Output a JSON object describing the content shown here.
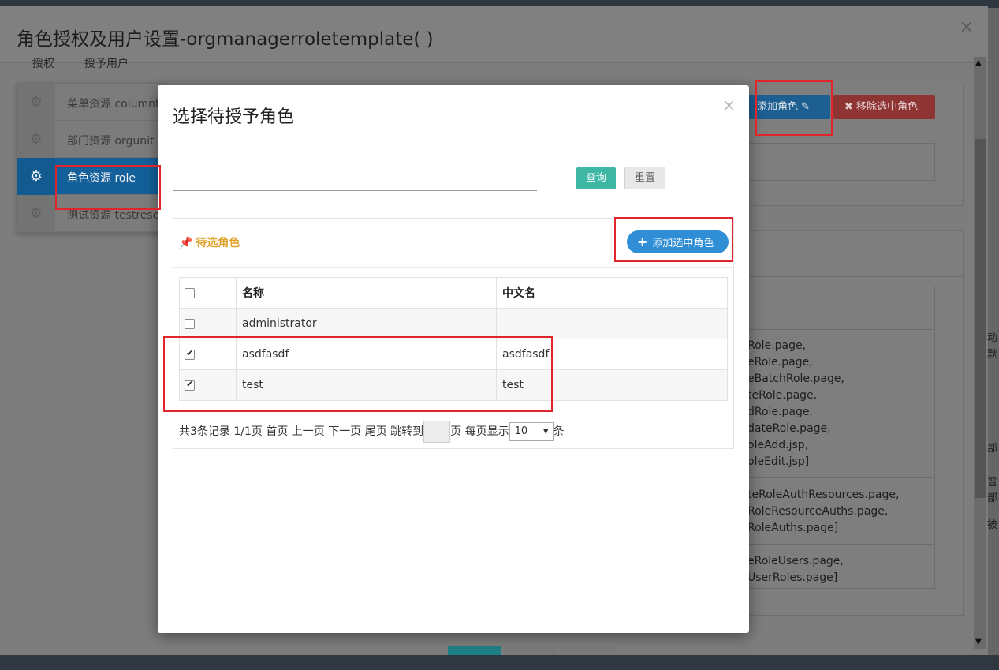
{
  "outer_modal": {
    "title": "角色授权及用户设置-orgmanagerroletemplate( )",
    "close": "×",
    "tabs": [
      {
        "label": "授权"
      },
      {
        "label": "授予用户"
      }
    ]
  },
  "resource_menu": {
    "items": [
      {
        "label": "菜单资源 columnt"
      },
      {
        "label": "部门资源 orgunit"
      },
      {
        "label": "角色资源 role"
      },
      {
        "label": "测试资源 testresou"
      }
    ]
  },
  "right_panel": {
    "add_role_label": "添加角色",
    "remove_role_label": "移除选中角色",
    "permissions": [
      [
        "Role.page,",
        "eRole.page,",
        "eBatchRole.page,",
        "teRole.page,",
        "dRole.page,",
        "dateRole.page,",
        "oleAdd.jsp,",
        "oleEdit.jsp]"
      ],
      [
        "teRoleAuthResources.page,",
        "RoleResourceAuths.page,",
        "RoleAuths.page]"
      ],
      [
        "eRoleUsers.page,",
        "UserRoles.page]"
      ]
    ],
    "edge_fragments": [
      "动",
      "默",
      "部",
      "普",
      "部",
      "被"
    ]
  },
  "dialog": {
    "title": "选择待授予角色",
    "close": "×",
    "search": {
      "value": "",
      "placeholder": ""
    },
    "query_label": "查询",
    "reset_label": "重置",
    "section_title": "待选角色",
    "add_selected_label": "添加选中角色",
    "table": {
      "headers": [
        "名称",
        "中文名"
      ],
      "rows": [
        {
          "name": "administrator",
          "cn_name": "",
          "checked": false
        },
        {
          "name": "asdfasdf",
          "cn_name": "asdfasdf",
          "checked": true
        },
        {
          "name": "test",
          "cn_name": "test",
          "checked": true
        }
      ]
    },
    "pager": {
      "summary": "共3条记录 1/1页",
      "first": "首页",
      "prev": "上一页",
      "next": "下一页",
      "last": "尾页",
      "jump_to": "跳转到",
      "page_unit": "页",
      "per_page": "每页显示",
      "page_size": "10",
      "per_unit": "条"
    }
  },
  "colors": {
    "primary": "#2f8ed6",
    "query_button": "#3fb7a5",
    "section_title": "#e0a32e",
    "highlight": "#e0262c",
    "active_menu": "#14609b"
  }
}
